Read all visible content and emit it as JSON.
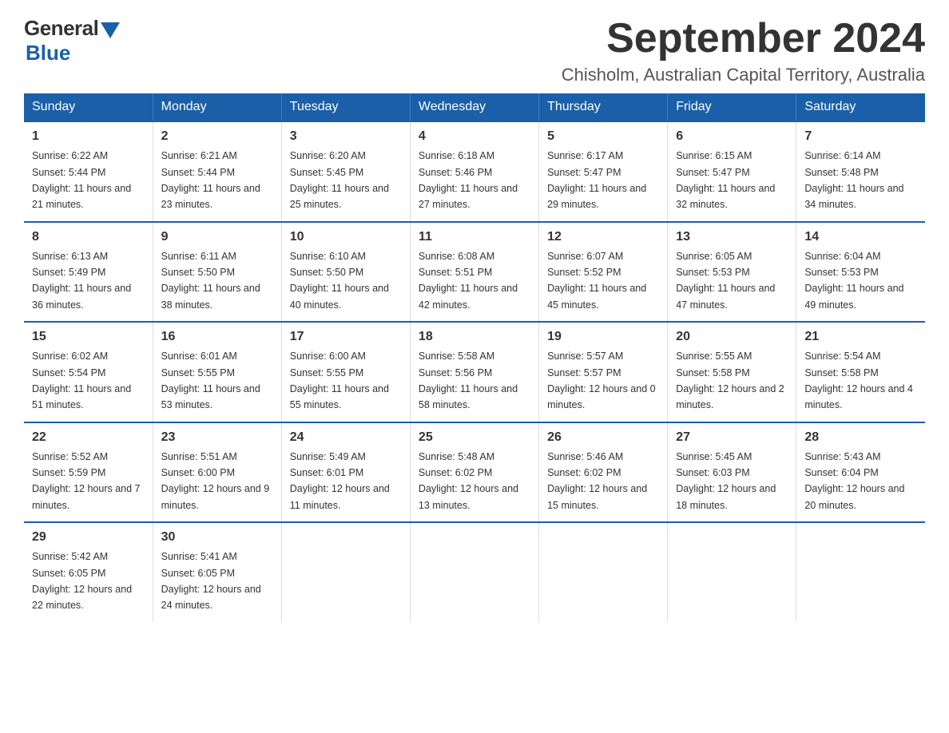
{
  "header": {
    "logo_general": "General",
    "logo_blue": "Blue",
    "month_title": "September 2024",
    "location": "Chisholm, Australian Capital Territory, Australia"
  },
  "days_of_week": [
    "Sunday",
    "Monday",
    "Tuesday",
    "Wednesday",
    "Thursday",
    "Friday",
    "Saturday"
  ],
  "weeks": [
    [
      {
        "day": "1",
        "sunrise": "6:22 AM",
        "sunset": "5:44 PM",
        "daylight": "11 hours and 21 minutes."
      },
      {
        "day": "2",
        "sunrise": "6:21 AM",
        "sunset": "5:44 PM",
        "daylight": "11 hours and 23 minutes."
      },
      {
        "day": "3",
        "sunrise": "6:20 AM",
        "sunset": "5:45 PM",
        "daylight": "11 hours and 25 minutes."
      },
      {
        "day": "4",
        "sunrise": "6:18 AM",
        "sunset": "5:46 PM",
        "daylight": "11 hours and 27 minutes."
      },
      {
        "day": "5",
        "sunrise": "6:17 AM",
        "sunset": "5:47 PM",
        "daylight": "11 hours and 29 minutes."
      },
      {
        "day": "6",
        "sunrise": "6:15 AM",
        "sunset": "5:47 PM",
        "daylight": "11 hours and 32 minutes."
      },
      {
        "day": "7",
        "sunrise": "6:14 AM",
        "sunset": "5:48 PM",
        "daylight": "11 hours and 34 minutes."
      }
    ],
    [
      {
        "day": "8",
        "sunrise": "6:13 AM",
        "sunset": "5:49 PM",
        "daylight": "11 hours and 36 minutes."
      },
      {
        "day": "9",
        "sunrise": "6:11 AM",
        "sunset": "5:50 PM",
        "daylight": "11 hours and 38 minutes."
      },
      {
        "day": "10",
        "sunrise": "6:10 AM",
        "sunset": "5:50 PM",
        "daylight": "11 hours and 40 minutes."
      },
      {
        "day": "11",
        "sunrise": "6:08 AM",
        "sunset": "5:51 PM",
        "daylight": "11 hours and 42 minutes."
      },
      {
        "day": "12",
        "sunrise": "6:07 AM",
        "sunset": "5:52 PM",
        "daylight": "11 hours and 45 minutes."
      },
      {
        "day": "13",
        "sunrise": "6:05 AM",
        "sunset": "5:53 PM",
        "daylight": "11 hours and 47 minutes."
      },
      {
        "day": "14",
        "sunrise": "6:04 AM",
        "sunset": "5:53 PM",
        "daylight": "11 hours and 49 minutes."
      }
    ],
    [
      {
        "day": "15",
        "sunrise": "6:02 AM",
        "sunset": "5:54 PM",
        "daylight": "11 hours and 51 minutes."
      },
      {
        "day": "16",
        "sunrise": "6:01 AM",
        "sunset": "5:55 PM",
        "daylight": "11 hours and 53 minutes."
      },
      {
        "day": "17",
        "sunrise": "6:00 AM",
        "sunset": "5:55 PM",
        "daylight": "11 hours and 55 minutes."
      },
      {
        "day": "18",
        "sunrise": "5:58 AM",
        "sunset": "5:56 PM",
        "daylight": "11 hours and 58 minutes."
      },
      {
        "day": "19",
        "sunrise": "5:57 AM",
        "sunset": "5:57 PM",
        "daylight": "12 hours and 0 minutes."
      },
      {
        "day": "20",
        "sunrise": "5:55 AM",
        "sunset": "5:58 PM",
        "daylight": "12 hours and 2 minutes."
      },
      {
        "day": "21",
        "sunrise": "5:54 AM",
        "sunset": "5:58 PM",
        "daylight": "12 hours and 4 minutes."
      }
    ],
    [
      {
        "day": "22",
        "sunrise": "5:52 AM",
        "sunset": "5:59 PM",
        "daylight": "12 hours and 7 minutes."
      },
      {
        "day": "23",
        "sunrise": "5:51 AM",
        "sunset": "6:00 PM",
        "daylight": "12 hours and 9 minutes."
      },
      {
        "day": "24",
        "sunrise": "5:49 AM",
        "sunset": "6:01 PM",
        "daylight": "12 hours and 11 minutes."
      },
      {
        "day": "25",
        "sunrise": "5:48 AM",
        "sunset": "6:02 PM",
        "daylight": "12 hours and 13 minutes."
      },
      {
        "day": "26",
        "sunrise": "5:46 AM",
        "sunset": "6:02 PM",
        "daylight": "12 hours and 15 minutes."
      },
      {
        "day": "27",
        "sunrise": "5:45 AM",
        "sunset": "6:03 PM",
        "daylight": "12 hours and 18 minutes."
      },
      {
        "day": "28",
        "sunrise": "5:43 AM",
        "sunset": "6:04 PM",
        "daylight": "12 hours and 20 minutes."
      }
    ],
    [
      {
        "day": "29",
        "sunrise": "5:42 AM",
        "sunset": "6:05 PM",
        "daylight": "12 hours and 22 minutes."
      },
      {
        "day": "30",
        "sunrise": "5:41 AM",
        "sunset": "6:05 PM",
        "daylight": "12 hours and 24 minutes."
      },
      {
        "day": "",
        "sunrise": "",
        "sunset": "",
        "daylight": ""
      },
      {
        "day": "",
        "sunrise": "",
        "sunset": "",
        "daylight": ""
      },
      {
        "day": "",
        "sunrise": "",
        "sunset": "",
        "daylight": ""
      },
      {
        "day": "",
        "sunrise": "",
        "sunset": "",
        "daylight": ""
      },
      {
        "day": "",
        "sunrise": "",
        "sunset": "",
        "daylight": ""
      }
    ]
  ]
}
